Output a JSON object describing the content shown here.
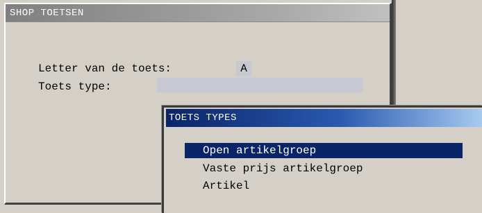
{
  "main_window": {
    "title": "SHOP TOETSEN",
    "letter_label": "Letter van de toets:",
    "letter_value": "A",
    "type_label": "Toets type:",
    "type_value": ""
  },
  "popup": {
    "title": "TOETS TYPES",
    "items": [
      {
        "label": "Open artikelgroep",
        "selected": true
      },
      {
        "label": "Vaste prijs artikelgroep",
        "selected": false
      },
      {
        "label": "Artikel",
        "selected": false
      }
    ]
  },
  "colors": {
    "background": "#d4d0c8",
    "main_titlebar": "#808080",
    "popup_titlebar": "#0a2468",
    "selection": "#0a2468",
    "field_bg": "#c8c8d2"
  }
}
